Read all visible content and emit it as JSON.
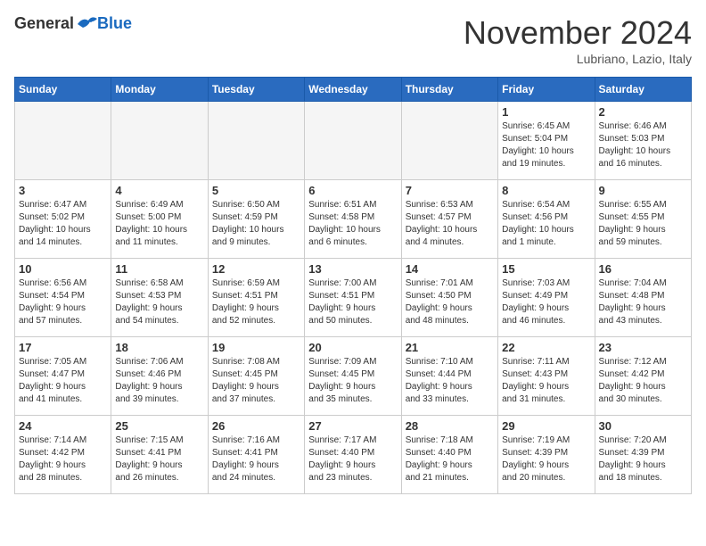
{
  "header": {
    "logo_general": "General",
    "logo_blue": "Blue",
    "month_title": "November 2024",
    "location": "Lubriano, Lazio, Italy"
  },
  "weekdays": [
    "Sunday",
    "Monday",
    "Tuesday",
    "Wednesday",
    "Thursday",
    "Friday",
    "Saturday"
  ],
  "weeks": [
    [
      {
        "day": "",
        "info": ""
      },
      {
        "day": "",
        "info": ""
      },
      {
        "day": "",
        "info": ""
      },
      {
        "day": "",
        "info": ""
      },
      {
        "day": "",
        "info": ""
      },
      {
        "day": "1",
        "info": "Sunrise: 6:45 AM\nSunset: 5:04 PM\nDaylight: 10 hours\nand 19 minutes."
      },
      {
        "day": "2",
        "info": "Sunrise: 6:46 AM\nSunset: 5:03 PM\nDaylight: 10 hours\nand 16 minutes."
      }
    ],
    [
      {
        "day": "3",
        "info": "Sunrise: 6:47 AM\nSunset: 5:02 PM\nDaylight: 10 hours\nand 14 minutes."
      },
      {
        "day": "4",
        "info": "Sunrise: 6:49 AM\nSunset: 5:00 PM\nDaylight: 10 hours\nand 11 minutes."
      },
      {
        "day": "5",
        "info": "Sunrise: 6:50 AM\nSunset: 4:59 PM\nDaylight: 10 hours\nand 9 minutes."
      },
      {
        "day": "6",
        "info": "Sunrise: 6:51 AM\nSunset: 4:58 PM\nDaylight: 10 hours\nand 6 minutes."
      },
      {
        "day": "7",
        "info": "Sunrise: 6:53 AM\nSunset: 4:57 PM\nDaylight: 10 hours\nand 4 minutes."
      },
      {
        "day": "8",
        "info": "Sunrise: 6:54 AM\nSunset: 4:56 PM\nDaylight: 10 hours\nand 1 minute."
      },
      {
        "day": "9",
        "info": "Sunrise: 6:55 AM\nSunset: 4:55 PM\nDaylight: 9 hours\nand 59 minutes."
      }
    ],
    [
      {
        "day": "10",
        "info": "Sunrise: 6:56 AM\nSunset: 4:54 PM\nDaylight: 9 hours\nand 57 minutes."
      },
      {
        "day": "11",
        "info": "Sunrise: 6:58 AM\nSunset: 4:53 PM\nDaylight: 9 hours\nand 54 minutes."
      },
      {
        "day": "12",
        "info": "Sunrise: 6:59 AM\nSunset: 4:51 PM\nDaylight: 9 hours\nand 52 minutes."
      },
      {
        "day": "13",
        "info": "Sunrise: 7:00 AM\nSunset: 4:51 PM\nDaylight: 9 hours\nand 50 minutes."
      },
      {
        "day": "14",
        "info": "Sunrise: 7:01 AM\nSunset: 4:50 PM\nDaylight: 9 hours\nand 48 minutes."
      },
      {
        "day": "15",
        "info": "Sunrise: 7:03 AM\nSunset: 4:49 PM\nDaylight: 9 hours\nand 46 minutes."
      },
      {
        "day": "16",
        "info": "Sunrise: 7:04 AM\nSunset: 4:48 PM\nDaylight: 9 hours\nand 43 minutes."
      }
    ],
    [
      {
        "day": "17",
        "info": "Sunrise: 7:05 AM\nSunset: 4:47 PM\nDaylight: 9 hours\nand 41 minutes."
      },
      {
        "day": "18",
        "info": "Sunrise: 7:06 AM\nSunset: 4:46 PM\nDaylight: 9 hours\nand 39 minutes."
      },
      {
        "day": "19",
        "info": "Sunrise: 7:08 AM\nSunset: 4:45 PM\nDaylight: 9 hours\nand 37 minutes."
      },
      {
        "day": "20",
        "info": "Sunrise: 7:09 AM\nSunset: 4:45 PM\nDaylight: 9 hours\nand 35 minutes."
      },
      {
        "day": "21",
        "info": "Sunrise: 7:10 AM\nSunset: 4:44 PM\nDaylight: 9 hours\nand 33 minutes."
      },
      {
        "day": "22",
        "info": "Sunrise: 7:11 AM\nSunset: 4:43 PM\nDaylight: 9 hours\nand 31 minutes."
      },
      {
        "day": "23",
        "info": "Sunrise: 7:12 AM\nSunset: 4:42 PM\nDaylight: 9 hours\nand 30 minutes."
      }
    ],
    [
      {
        "day": "24",
        "info": "Sunrise: 7:14 AM\nSunset: 4:42 PM\nDaylight: 9 hours\nand 28 minutes."
      },
      {
        "day": "25",
        "info": "Sunrise: 7:15 AM\nSunset: 4:41 PM\nDaylight: 9 hours\nand 26 minutes."
      },
      {
        "day": "26",
        "info": "Sunrise: 7:16 AM\nSunset: 4:41 PM\nDaylight: 9 hours\nand 24 minutes."
      },
      {
        "day": "27",
        "info": "Sunrise: 7:17 AM\nSunset: 4:40 PM\nDaylight: 9 hours\nand 23 minutes."
      },
      {
        "day": "28",
        "info": "Sunrise: 7:18 AM\nSunset: 4:40 PM\nDaylight: 9 hours\nand 21 minutes."
      },
      {
        "day": "29",
        "info": "Sunrise: 7:19 AM\nSunset: 4:39 PM\nDaylight: 9 hours\nand 20 minutes."
      },
      {
        "day": "30",
        "info": "Sunrise: 7:20 AM\nSunset: 4:39 PM\nDaylight: 9 hours\nand 18 minutes."
      }
    ]
  ]
}
